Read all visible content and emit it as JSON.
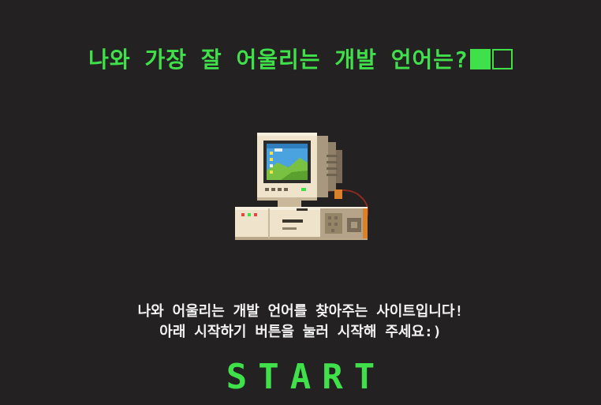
{
  "title": {
    "text": "나와 가장 잘 어울리는 개발 언어는?"
  },
  "description": {
    "line1": "나와 어울리는 개발 언어를 찾아주는 사이트입니다!",
    "line2": "아래 시작하기 버튼을 눌러 시작해 주세요:)"
  },
  "start_button": {
    "label": "START"
  },
  "colors": {
    "background": "#232121",
    "accent": "#3fe04a",
    "text": "#f2f2f2"
  },
  "icons": {
    "computer": "retro-computer-icon"
  }
}
